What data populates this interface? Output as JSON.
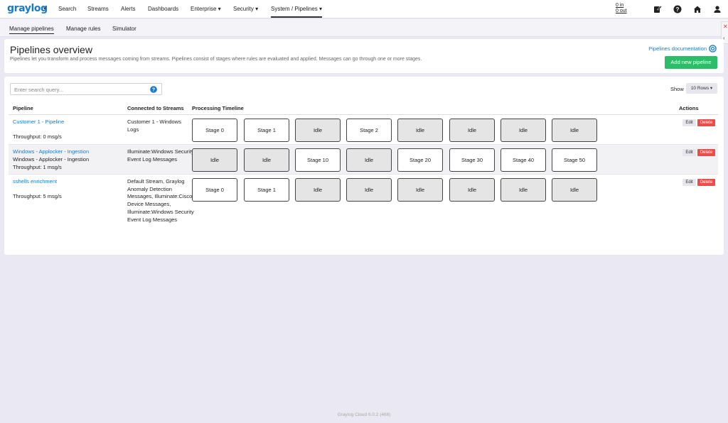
{
  "topnav": {
    "logo": "graylog",
    "items": [
      "Search",
      "Streams",
      "Alerts",
      "Dashboards",
      "Enterprise ▾",
      "Security ▾",
      "System / Pipelines ▾"
    ],
    "throughput_in": "0 in",
    "throughput_out": "0 out",
    "icons": [
      "edit-icon",
      "help-icon",
      "home-icon",
      "user-icon"
    ]
  },
  "subnav": {
    "items": [
      "Manage pipelines",
      "Manage rules",
      "Simulator"
    ]
  },
  "header": {
    "title": "Pipelines overview",
    "description": "Pipelines let you transform and process messages coming from streams. Pipelines consist of stages where rules are evaluated and applied. Messages can go through one or more stages.",
    "doc_link": "Pipelines documentation",
    "add_button": "Add new pipeline"
  },
  "search": {
    "placeholder": "Enter search query..."
  },
  "show": {
    "label": "Show",
    "rows": "10 Rows ▾"
  },
  "table": {
    "headers": [
      "Pipeline",
      "Connected to Streams",
      "Processing Timeline",
      "Actions"
    ],
    "edit_label": "Edit",
    "delete_label": "Delete",
    "rows": [
      {
        "name": "Customer 1 - Pipeline",
        "description": "",
        "throughput": "Throughput: 0 msg/s",
        "streams": "Customer 1 - Windows Logs",
        "stages": [
          "Stage 0",
          "Stage 1",
          "Idle",
          "Stage 2",
          "Idle",
          "Idle",
          "Idle",
          "Idle"
        ]
      },
      {
        "name": "Windows - Applocker - Ingestion",
        "description": "Windows - Applocker - Ingestion",
        "throughput": "Throughput: 1 msg/s",
        "streams": "Illuminate:Windows Security Event Log Messages",
        "stages": [
          "Idle",
          "Idle",
          "Stage 10",
          "Idle",
          "Stage 20",
          "Stage 30",
          "Stage 40",
          "Stage 50"
        ]
      },
      {
        "name": "sshells enrichment",
        "description": "",
        "throughput": "Throughput: 5 msg/s",
        "streams": "Default Stream, Graylog Anomaly Detection Messages, Illuminate:Cisco Device Messages, Illuminate:Windows Security Event Log Messages",
        "stages": [
          "Stage 0",
          "Stage 1",
          "Idle",
          "Idle",
          "Idle",
          "Idle",
          "Idle",
          "Idle"
        ]
      }
    ]
  },
  "side_tab": {
    "close": "✕",
    "chevron": "‹"
  },
  "footer": "Graylog Cloud 6.0.2 (466)",
  "colors": {
    "brand": "#1b7ac3",
    "add_button": "#2bbd67",
    "delete": "#eb4d4b",
    "page_bg": "#e9e8f3"
  }
}
